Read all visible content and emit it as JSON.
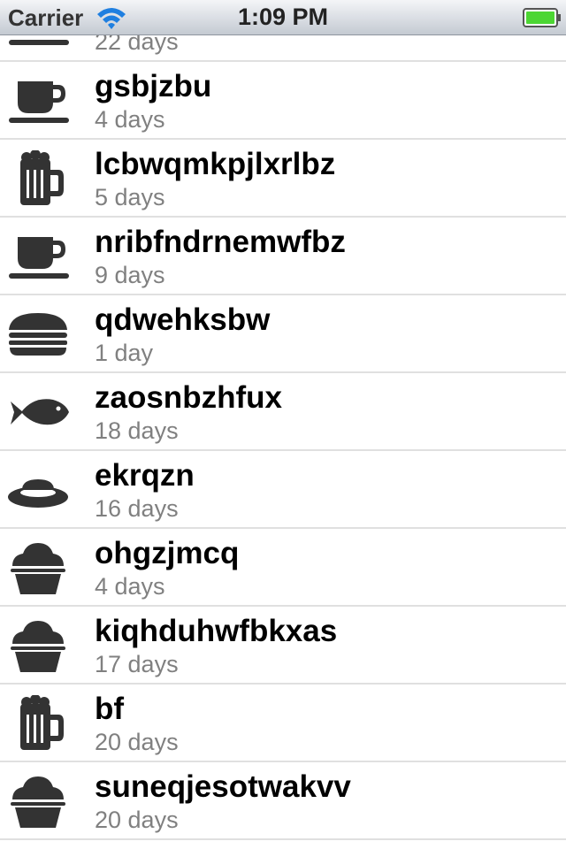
{
  "status_bar": {
    "carrier": "Carrier",
    "time": "1:09 PM",
    "battery_color": "#4cd633"
  },
  "list": {
    "items": [
      {
        "title": "",
        "subtitle": "22 days",
        "icon": "coffee-cup-icon"
      },
      {
        "title": "gsbjzbu",
        "subtitle": "4 days",
        "icon": "coffee-cup-icon"
      },
      {
        "title": "lcbwqmkpjlxrlbz",
        "subtitle": "5 days",
        "icon": "beer-mug-icon"
      },
      {
        "title": "nribfndrnemwfbz",
        "subtitle": "9 days",
        "icon": "coffee-cup-icon"
      },
      {
        "title": "qdwehksbw",
        "subtitle": "1 day",
        "icon": "burger-icon"
      },
      {
        "title": "zaosnbzhfux",
        "subtitle": "18 days",
        "icon": "fish-icon"
      },
      {
        "title": "ekrqzn",
        "subtitle": "16 days",
        "icon": "plate-icon"
      },
      {
        "title": "ohgzjmcq",
        "subtitle": "4 days",
        "icon": "cupcake-icon"
      },
      {
        "title": "kiqhduhwfbkxas",
        "subtitle": "17 days",
        "icon": "cupcake-icon"
      },
      {
        "title": "bf",
        "subtitle": "20 days",
        "icon": "beer-mug-icon"
      },
      {
        "title": "suneqjesotwakvv",
        "subtitle": "20 days",
        "icon": "cupcake-icon"
      }
    ]
  }
}
